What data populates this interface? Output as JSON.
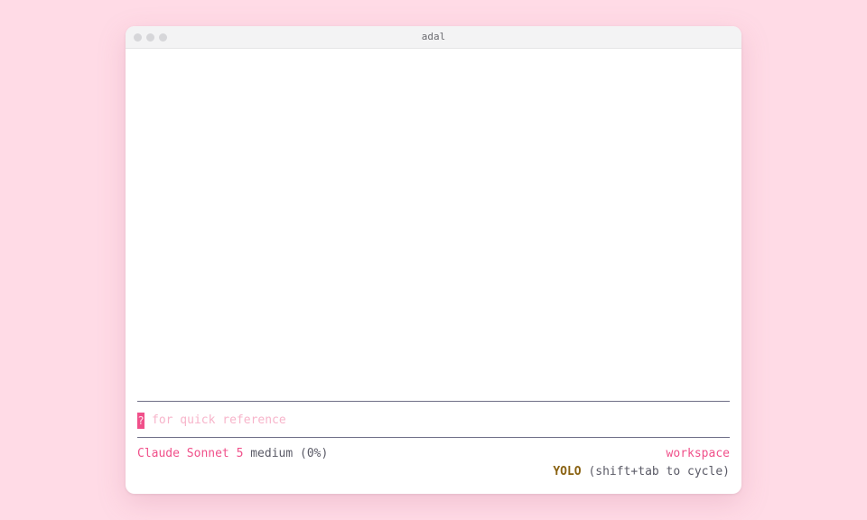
{
  "window": {
    "title": "adal"
  },
  "prompt": {
    "key": "?",
    "hint": "for quick reference"
  },
  "status": {
    "model": "Claude Sonnet 5",
    "effort": "medium (0%)",
    "workspace": "workspace",
    "mode": "YOLO",
    "mode_hint": "(shift+tab to cycle)"
  },
  "colors": {
    "background": "#ffdbe6",
    "accent": "#f0508a",
    "mode": "#8a6212"
  }
}
